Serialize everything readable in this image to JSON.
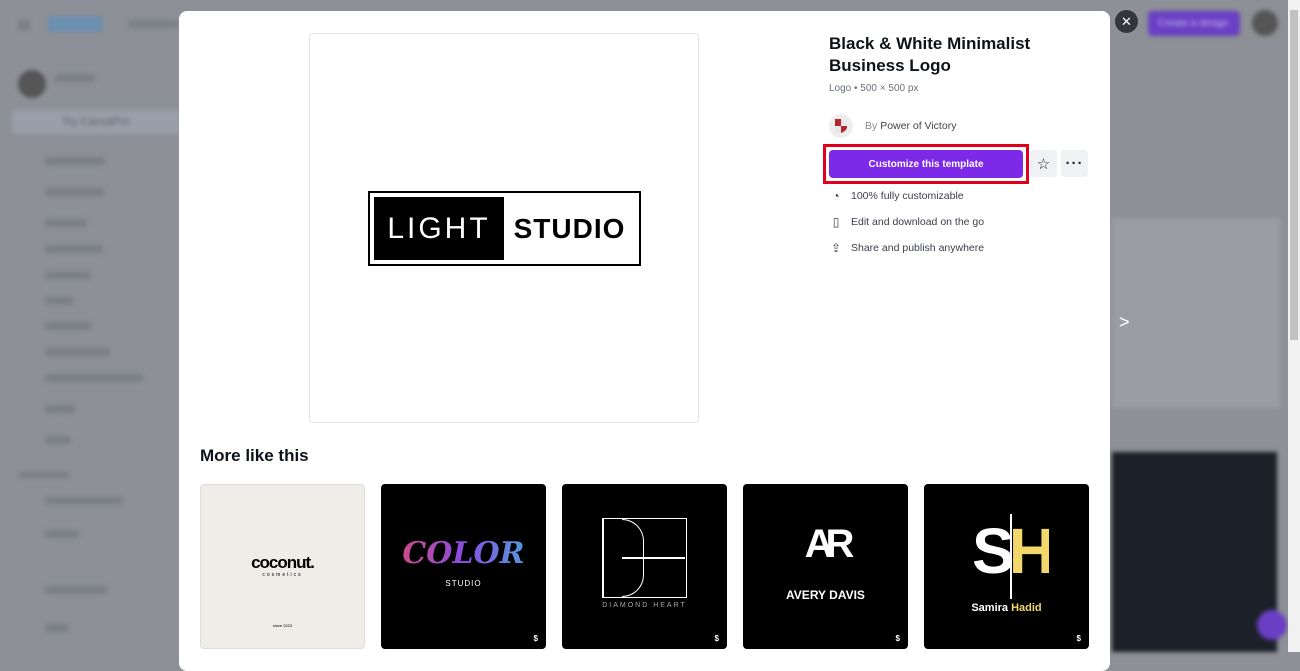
{
  "background": {
    "pro_label": "Try CanvaPro",
    "create_label": "Create a design"
  },
  "modal": {
    "title": "Black & White Minimalist Business Logo",
    "meta": "Logo • 500 × 500 px",
    "author_prefix": "By",
    "author": "Power of Victory",
    "cta": "Customize this template",
    "features": [
      {
        "icon": "palette-icon",
        "label": "100% fully customizable"
      },
      {
        "icon": "phone-icon",
        "label": "Edit and download on the go"
      },
      {
        "icon": "share-icon",
        "label": "Share and publish anywhere"
      }
    ],
    "preview_logo": {
      "left": "LIGHT",
      "right": "STUDIO"
    },
    "more_title": "More like this",
    "more": [
      {
        "name": "coconut.",
        "sub": "cosmetics",
        "extra": "since 2023",
        "pro": ""
      },
      {
        "name": "COLOR",
        "sub": "STUDIO",
        "pro": "$"
      },
      {
        "name": "DH",
        "sub": "DIAMOND HEART",
        "pro": "$"
      },
      {
        "name": "AR",
        "sub": "AVERY DAVIS",
        "pro": "$"
      },
      {
        "name": "SH",
        "sub": "Samira",
        "sub2": "Hadid",
        "pro": "$"
      }
    ]
  },
  "colors": {
    "accent": "#7d2ae8",
    "highlight": "#e0001b",
    "overlay": "#8d9096"
  }
}
